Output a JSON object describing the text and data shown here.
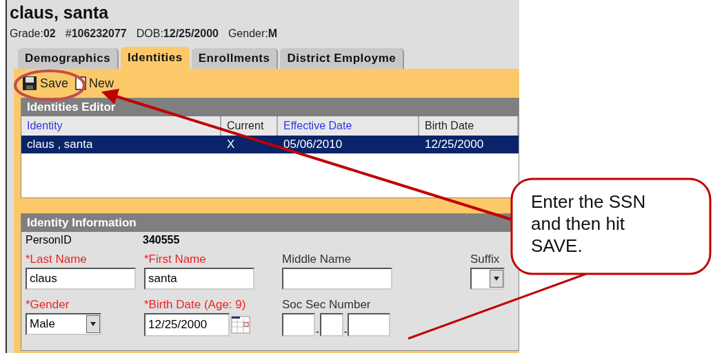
{
  "student": {
    "name": "claus, santa",
    "details": [
      {
        "label": "Grade:",
        "value": "02"
      },
      {
        "label": "#",
        "value": "106232077"
      },
      {
        "label": "DOB:",
        "value": "12/25/2000"
      },
      {
        "label": "Gender:",
        "value": "M"
      }
    ]
  },
  "tabs": [
    {
      "label": "Demographics",
      "selected": false
    },
    {
      "label": "Identities",
      "selected": true
    },
    {
      "label": "Enrollments",
      "selected": false
    },
    {
      "label": "District Employme",
      "selected": false
    }
  ],
  "toolbar": [
    {
      "label": "Save",
      "kind": "save"
    },
    {
      "label": "New",
      "kind": "new"
    }
  ],
  "editor": {
    "title": "Identities Editor",
    "columns": [
      {
        "label": "Identity",
        "link": true
      },
      {
        "label": "Current",
        "link": false
      },
      {
        "label": "Effective Date",
        "link": true
      },
      {
        "label": "Birth Date",
        "link": false
      }
    ],
    "rows": [
      {
        "cells": [
          "claus , santa",
          "X",
          "05/06/2010",
          "12/25/2000"
        ],
        "selected": true
      }
    ]
  },
  "identity_info": {
    "title": "Identity Information",
    "person_id": {
      "label": "PersonID",
      "value": "340555"
    },
    "fields": [
      {
        "label": "*Last Name",
        "required": true,
        "kind": "text",
        "value": "claus"
      },
      {
        "label": "*First Name",
        "required": true,
        "kind": "text",
        "value": "santa"
      },
      {
        "label": "Middle Name",
        "required": false,
        "kind": "text"
      },
      {
        "label": "Suffix",
        "required": false,
        "kind": "select"
      },
      {
        "label": "*Gender",
        "required": true,
        "kind": "select",
        "value": "Male"
      },
      {
        "label": "*Birth Date (Age: 9)",
        "required": true,
        "kind": "date",
        "value": "12/25/2000"
      },
      {
        "label": "Soc Sec Number",
        "required": false,
        "kind": "ssn",
        "separator": "-"
      }
    ]
  },
  "callout": {
    "text": "Enter the SSN and then hit SAVE."
  }
}
